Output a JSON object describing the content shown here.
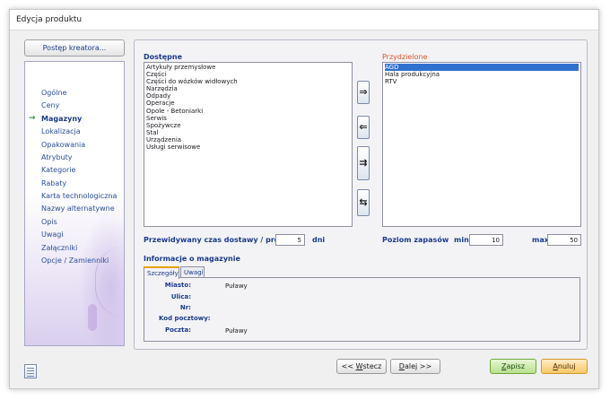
{
  "window": {
    "title": "Edycja produktu"
  },
  "wizard_button": "Postęp kreatora...",
  "sidebar": {
    "items": [
      {
        "label": "Ogólne"
      },
      {
        "label": "Ceny"
      },
      {
        "label": "Magazyny",
        "active": true
      },
      {
        "label": "Lokalizacja"
      },
      {
        "label": "Opakowania"
      },
      {
        "label": "Atrybuty"
      },
      {
        "label": "Kategorie"
      },
      {
        "label": "Rabaty"
      },
      {
        "label": "Karta technologiczna"
      },
      {
        "label": "Nazwy alternatywne"
      },
      {
        "label": "Opis"
      },
      {
        "label": "Uwagi"
      },
      {
        "label": "Załączniki"
      },
      {
        "label": "Opcje / Zamienniki"
      }
    ],
    "active_arrow": "→"
  },
  "available": {
    "label": "Dostępne",
    "items": [
      "Artykuły przemysłowe",
      "Części",
      "Części do wózków widłowych",
      "Narzędzia",
      "Odpady",
      "Operacje",
      "Opole - Betoniarki",
      "Serwis",
      "Spożywcze",
      "Stal",
      "Urządzenia",
      "Usługi serwisowe"
    ]
  },
  "assigned": {
    "label": "Przydzielone",
    "items": [
      "AGD",
      "Hala produkcyjna",
      "RTV"
    ],
    "selected": "AGD"
  },
  "move_buttons": {
    "add": "⇒",
    "remove": "⇐",
    "add_all": "⇉",
    "swap": "⇆"
  },
  "delivery": {
    "label": "Przewidywany czas dostawy / produkcji",
    "value": "5",
    "unit": "dni"
  },
  "stock": {
    "label": "Poziom zapasów",
    "min_label": "min",
    "min_value": "10",
    "max_label": "max",
    "max_value": "50"
  },
  "warehouse_info": {
    "label": "Informacje o magazynie",
    "tabs": [
      "Szczegóły",
      "Uwagi"
    ],
    "fields": [
      {
        "label": "Miasto:",
        "value": "Puławy"
      },
      {
        "label": "Ulica:",
        "value": ""
      },
      {
        "label": "Nr:",
        "value": ""
      },
      {
        "label": "Kod pocztowy:",
        "value": ""
      },
      {
        "label": "Poczta:",
        "value": "Puławy"
      }
    ]
  },
  "footer": {
    "back": {
      "prefix": "<< ",
      "accel": "W",
      "rest": "stecz"
    },
    "next": {
      "accel": "D",
      "rest": "alej >>"
    },
    "save": {
      "accel": "Z",
      "rest": "apisz"
    },
    "cancel": {
      "accel": "A",
      "rest": "nuluj"
    }
  },
  "colors": {
    "label_blue": "#1a3a8a",
    "accent_red": "#d9542b",
    "selection": "#3070d0",
    "save_green": "#b8e08c",
    "cancel_orange": "#f6c768"
  }
}
